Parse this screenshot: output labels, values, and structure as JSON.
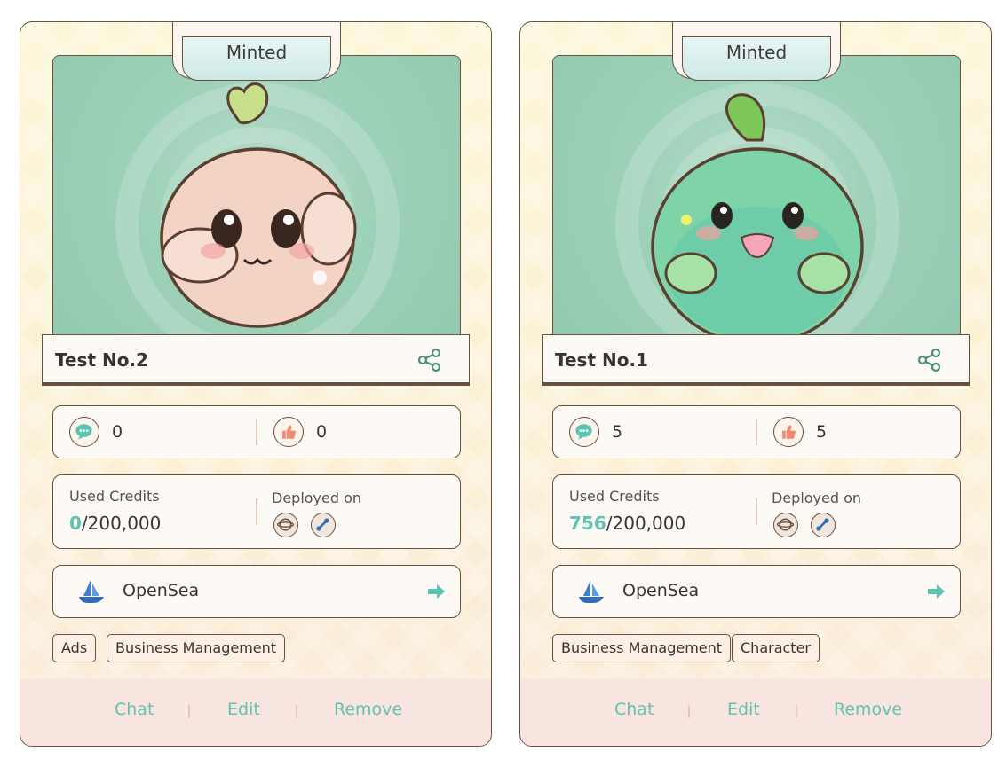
{
  "cards": [
    {
      "status": "Minted",
      "name": "Test No.2",
      "comments": "0",
      "likes": "0",
      "credits_label": "Used Credits",
      "credits_used": "0",
      "credits_total": "/200,000",
      "deployed_label": "Deployed on",
      "marketplace": "OpenSea",
      "tags": [
        "Ads",
        "Business Management"
      ],
      "actions": [
        "Chat",
        "Edit",
        "Remove"
      ],
      "character_color": "#f3d3c4"
    },
    {
      "status": "Minted",
      "name": "Test No.1",
      "comments": "5",
      "likes": "5",
      "credits_label": "Used Credits",
      "credits_used": "756",
      "credits_total": "/200,000",
      "deployed_label": "Deployed on",
      "marketplace": "OpenSea",
      "tags": [
        "Business Management",
        "Character"
      ],
      "actions": [
        "Chat",
        "Edit",
        "Remove"
      ],
      "character_color": "#7fd3a8"
    }
  ],
  "colors": {
    "accent": "#62c3ad",
    "border": "#6a5040",
    "footer": "#f8e5df"
  },
  "icons": [
    "share-icon",
    "comment-icon",
    "like-icon",
    "chain-icon",
    "link-icon",
    "opensea-icon",
    "arrow-right-icon"
  ]
}
